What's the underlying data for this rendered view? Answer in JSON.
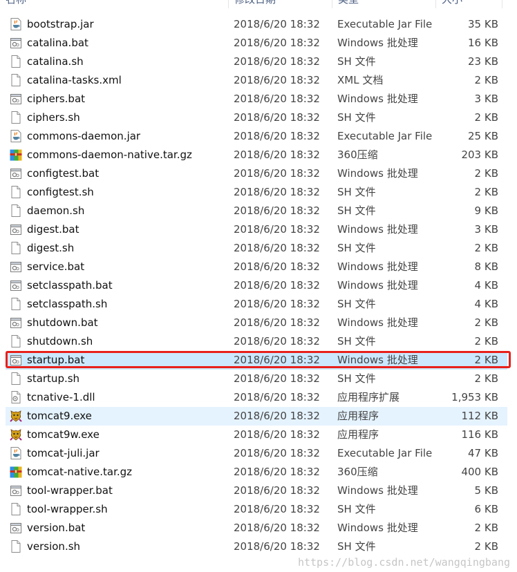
{
  "columns": {
    "name": "名称",
    "date": "修改日期",
    "type": "类型",
    "size": "大小"
  },
  "files": [
    {
      "name": "bootstrap.jar",
      "date": "2018/6/20 18:32",
      "type": "Executable Jar File",
      "size": "35 KB",
      "icon": "jar-icon"
    },
    {
      "name": "catalina.bat",
      "date": "2018/6/20 18:32",
      "type": "Windows 批处理",
      "size": "16 KB",
      "icon": "bat-icon"
    },
    {
      "name": "catalina.sh",
      "date": "2018/6/20 18:32",
      "type": "SH 文件",
      "size": "23 KB",
      "icon": "file-icon"
    },
    {
      "name": "catalina-tasks.xml",
      "date": "2018/6/20 18:32",
      "type": "XML 文档",
      "size": "2 KB",
      "icon": "file-icon"
    },
    {
      "name": "ciphers.bat",
      "date": "2018/6/20 18:32",
      "type": "Windows 批处理",
      "size": "3 KB",
      "icon": "bat-icon"
    },
    {
      "name": "ciphers.sh",
      "date": "2018/6/20 18:32",
      "type": "SH 文件",
      "size": "2 KB",
      "icon": "file-icon"
    },
    {
      "name": "commons-daemon.jar",
      "date": "2018/6/20 18:32",
      "type": "Executable Jar File",
      "size": "25 KB",
      "icon": "jar-icon"
    },
    {
      "name": "commons-daemon-native.tar.gz",
      "date": "2018/6/20 18:32",
      "type": "360压缩",
      "size": "203 KB",
      "icon": "archive-icon"
    },
    {
      "name": "configtest.bat",
      "date": "2018/6/20 18:32",
      "type": "Windows 批处理",
      "size": "2 KB",
      "icon": "bat-icon"
    },
    {
      "name": "configtest.sh",
      "date": "2018/6/20 18:32",
      "type": "SH 文件",
      "size": "2 KB",
      "icon": "file-icon"
    },
    {
      "name": "daemon.sh",
      "date": "2018/6/20 18:32",
      "type": "SH 文件",
      "size": "9 KB",
      "icon": "file-icon"
    },
    {
      "name": "digest.bat",
      "date": "2018/6/20 18:32",
      "type": "Windows 批处理",
      "size": "3 KB",
      "icon": "bat-icon"
    },
    {
      "name": "digest.sh",
      "date": "2018/6/20 18:32",
      "type": "SH 文件",
      "size": "2 KB",
      "icon": "file-icon"
    },
    {
      "name": "service.bat",
      "date": "2018/6/20 18:32",
      "type": "Windows 批处理",
      "size": "8 KB",
      "icon": "bat-icon"
    },
    {
      "name": "setclasspath.bat",
      "date": "2018/6/20 18:32",
      "type": "Windows 批处理",
      "size": "4 KB",
      "icon": "bat-icon"
    },
    {
      "name": "setclasspath.sh",
      "date": "2018/6/20 18:32",
      "type": "SH 文件",
      "size": "4 KB",
      "icon": "file-icon"
    },
    {
      "name": "shutdown.bat",
      "date": "2018/6/20 18:32",
      "type": "Windows 批处理",
      "size": "2 KB",
      "icon": "bat-icon"
    },
    {
      "name": "shutdown.sh",
      "date": "2018/6/20 18:32",
      "type": "SH 文件",
      "size": "2 KB",
      "icon": "file-icon"
    },
    {
      "name": "startup.bat",
      "date": "2018/6/20 18:32",
      "type": "Windows 批处理",
      "size": "2 KB",
      "icon": "bat-icon",
      "state": "selected"
    },
    {
      "name": "startup.sh",
      "date": "2018/6/20 18:32",
      "type": "SH 文件",
      "size": "2 KB",
      "icon": "file-icon"
    },
    {
      "name": "tcnative-1.dll",
      "date": "2018/6/20 18:32",
      "type": "应用程序扩展",
      "size": "1,953 KB",
      "icon": "dll-icon"
    },
    {
      "name": "tomcat9.exe",
      "date": "2018/6/20 18:32",
      "type": "应用程序",
      "size": "112 KB",
      "icon": "tomcat-icon",
      "state": "hover"
    },
    {
      "name": "tomcat9w.exe",
      "date": "2018/6/20 18:32",
      "type": "应用程序",
      "size": "116 KB",
      "icon": "tomcat-icon"
    },
    {
      "name": "tomcat-juli.jar",
      "date": "2018/6/20 18:32",
      "type": "Executable Jar File",
      "size": "47 KB",
      "icon": "jar-icon"
    },
    {
      "name": "tomcat-native.tar.gz",
      "date": "2018/6/20 18:32",
      "type": "360压缩",
      "size": "400 KB",
      "icon": "archive-icon"
    },
    {
      "name": "tool-wrapper.bat",
      "date": "2018/6/20 18:32",
      "type": "Windows 批处理",
      "size": "5 KB",
      "icon": "bat-icon"
    },
    {
      "name": "tool-wrapper.sh",
      "date": "2018/6/20 18:32",
      "type": "SH 文件",
      "size": "6 KB",
      "icon": "file-icon"
    },
    {
      "name": "version.bat",
      "date": "2018/6/20 18:32",
      "type": "Windows 批处理",
      "size": "2 KB",
      "icon": "bat-icon"
    },
    {
      "name": "version.sh",
      "date": "2018/6/20 18:32",
      "type": "SH 文件",
      "size": "2 KB",
      "icon": "file-icon"
    }
  ],
  "watermark": "https://blog.csdn.net/wangqingbang",
  "colors": {
    "selected_row": "#cce8ff",
    "hover_row": "#e5f3ff",
    "highlight_box": "#e8201a",
    "header_text": "#4d6082"
  }
}
